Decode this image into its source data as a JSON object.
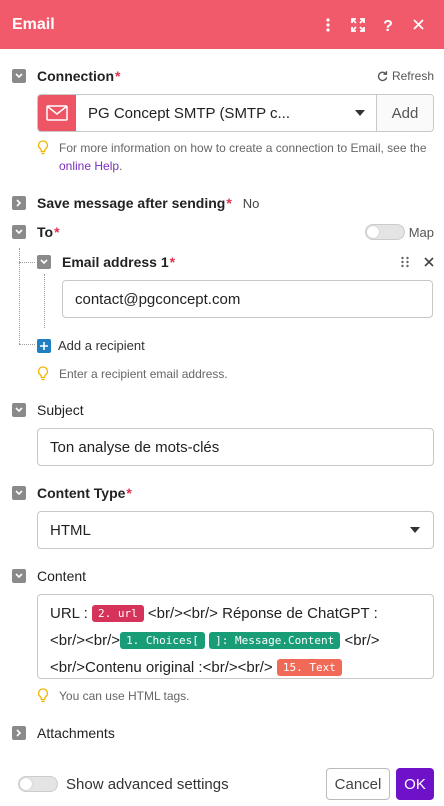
{
  "header": {
    "title": "Email"
  },
  "connection": {
    "label": "Connection",
    "required": "*",
    "refresh_label": "Refresh",
    "selected": "PG Concept SMTP (SMTP c...",
    "add_label": "Add",
    "hint_text": "For more information on how to create a connection to Email, see the ",
    "hint_link": "online Help",
    "hint_end": "."
  },
  "save_message": {
    "label": "Save message after sending",
    "required": "*",
    "value": "No"
  },
  "to": {
    "label": "To",
    "required": "*",
    "map_label": "Map",
    "item_label": "Email address 1",
    "item_required": "*",
    "item_value": "contact@pgconcept.com",
    "add_recipient": "Add a recipient",
    "hint": "Enter a recipient email address."
  },
  "subject": {
    "label": "Subject",
    "value": "Ton analyse de mots-clés"
  },
  "content_type": {
    "label": "Content Type",
    "required": "*",
    "value": "HTML"
  },
  "content": {
    "label": "Content",
    "text1": "URL :",
    "pill1": "2. url",
    "text2": "<br/><br/> Réponse de ChatGPT :",
    "text3": "<br/><br/>",
    "pill2a": "1. Choices[",
    "pill2b": "]: Message.Content",
    "text4": "<br/>",
    "text5": "<br/>Contenu original :<br/><br/>",
    "pill3": "15. Text",
    "hint": "You can use HTML tags."
  },
  "attachments": {
    "label": "Attachments"
  },
  "footer": {
    "advanced_label": "Show advanced settings",
    "cancel_label": "Cancel",
    "ok_label": "OK"
  },
  "colors": {
    "header": "#f05a6b",
    "accent": "#6e12c9",
    "pink_pill": "#d6335a",
    "green_pill": "#199c78",
    "orange_pill": "#f16a58"
  }
}
